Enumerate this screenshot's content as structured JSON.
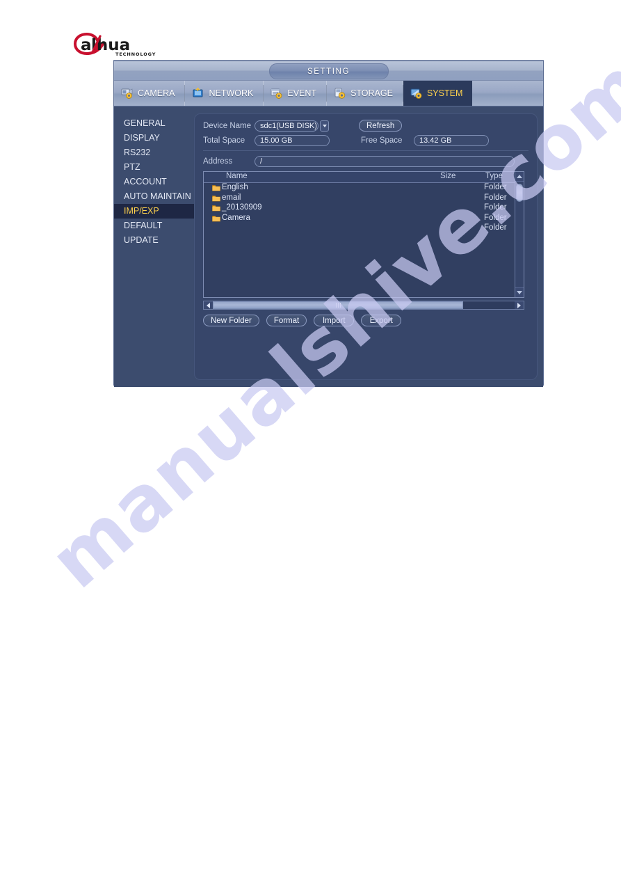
{
  "brand": {
    "name": "alhua",
    "tagline": "TECHNOLOGY"
  },
  "watermark": {
    "text": "manualshive.com"
  },
  "dialog": {
    "title": "SETTING",
    "tabs": [
      {
        "label": "CAMERA",
        "icon": "camera-gear-icon",
        "active": false
      },
      {
        "label": "NETWORK",
        "icon": "network-icon",
        "active": false
      },
      {
        "label": "EVENT",
        "icon": "event-gear-icon",
        "active": false
      },
      {
        "label": "STORAGE",
        "icon": "storage-gear-icon",
        "active": false
      },
      {
        "label": "SYSTEM",
        "icon": "system-gear-icon",
        "active": true
      }
    ],
    "sidebar": {
      "items": [
        {
          "label": "GENERAL",
          "active": false
        },
        {
          "label": "DISPLAY",
          "active": false
        },
        {
          "label": "RS232",
          "active": false
        },
        {
          "label": "PTZ",
          "active": false
        },
        {
          "label": "ACCOUNT",
          "active": false
        },
        {
          "label": "AUTO MAINTAIN",
          "active": false
        },
        {
          "label": "IMP/EXP",
          "active": true
        },
        {
          "label": "DEFAULT",
          "active": false
        },
        {
          "label": "UPDATE",
          "active": false
        }
      ]
    },
    "form": {
      "device_name_label": "Device Name",
      "device_name_value": "sdc1(USB DISK)",
      "refresh_label": "Refresh",
      "total_space_label": "Total Space",
      "total_space_value": "15.00 GB",
      "free_space_label": "Free Space",
      "free_space_value": "13.42 GB",
      "address_label": "Address",
      "address_value": "/"
    },
    "filelist": {
      "columns": {
        "name": "Name",
        "size": "Size",
        "type": "Type"
      },
      "rows": [
        {
          "name": "English",
          "size": "",
          "type": "Folder",
          "icon": "folder-icon"
        },
        {
          "name": "email",
          "size": "",
          "type": "Folder",
          "icon": "folder-icon"
        },
        {
          "name": "_20130909",
          "size": "",
          "type": "Folder",
          "icon": "folder-icon"
        },
        {
          "name": "Camera",
          "size": "",
          "type": "Folder",
          "icon": "folder-icon"
        },
        {
          "name": "",
          "size": "",
          "type": "Folder",
          "icon": ""
        }
      ]
    },
    "actions": {
      "new_folder": "New Folder",
      "format": "Format",
      "import": "Import",
      "export": "Export"
    }
  },
  "colors": {
    "dialog_bg": "#3c4c6e",
    "panel_bg": "#37466a",
    "accent_yellow": "#ffd24d",
    "selected_bg": "#1e2744",
    "brand_red": "#c8102e",
    "folder_orange": "#f0a830"
  }
}
